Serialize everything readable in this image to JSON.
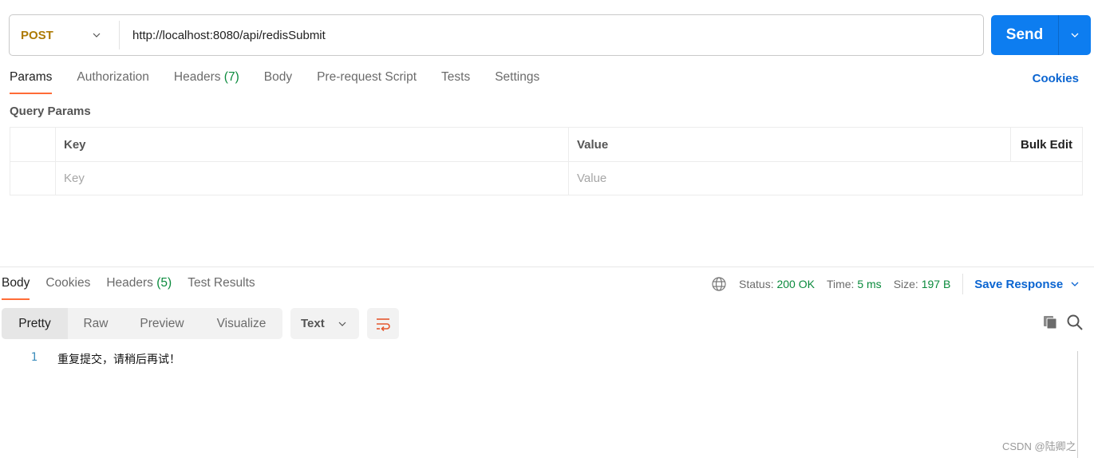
{
  "request": {
    "method": "POST",
    "url": "http://localhost:8080/api/redisSubmit",
    "send_label": "Send"
  },
  "request_tabs": [
    {
      "label": "Params",
      "active": true
    },
    {
      "label": "Authorization"
    },
    {
      "label": "Headers",
      "count": "(7)"
    },
    {
      "label": "Body"
    },
    {
      "label": "Pre-request Script"
    },
    {
      "label": "Tests"
    },
    {
      "label": "Settings"
    }
  ],
  "cookies_link": "Cookies",
  "query_params": {
    "title": "Query Params",
    "headers": {
      "key": "Key",
      "value": "Value",
      "bulk_edit": "Bulk Edit"
    },
    "placeholders": {
      "key": "Key",
      "value": "Value"
    }
  },
  "response_tabs": [
    {
      "label": "Body",
      "active": true
    },
    {
      "label": "Cookies"
    },
    {
      "label": "Headers",
      "count": "(5)"
    },
    {
      "label": "Test Results"
    }
  ],
  "response_meta": {
    "status_label": "Status:",
    "status_value": "200 OK",
    "time_label": "Time:",
    "time_value": "5 ms",
    "size_label": "Size:",
    "size_value": "197 B",
    "save_response": "Save Response"
  },
  "format_tabs": [
    "Pretty",
    "Raw",
    "Preview",
    "Visualize"
  ],
  "format_select": "Text",
  "response_body": [
    {
      "line": "1",
      "text": "重复提交，请稍后再试！"
    }
  ],
  "watermark": "CSDN @陆卿之",
  "colors": {
    "accent": "#ff6c37",
    "primary": "#0d7df0",
    "method_post": "#ad7a03",
    "success": "#0a8a3c",
    "link": "#0b65d1"
  }
}
